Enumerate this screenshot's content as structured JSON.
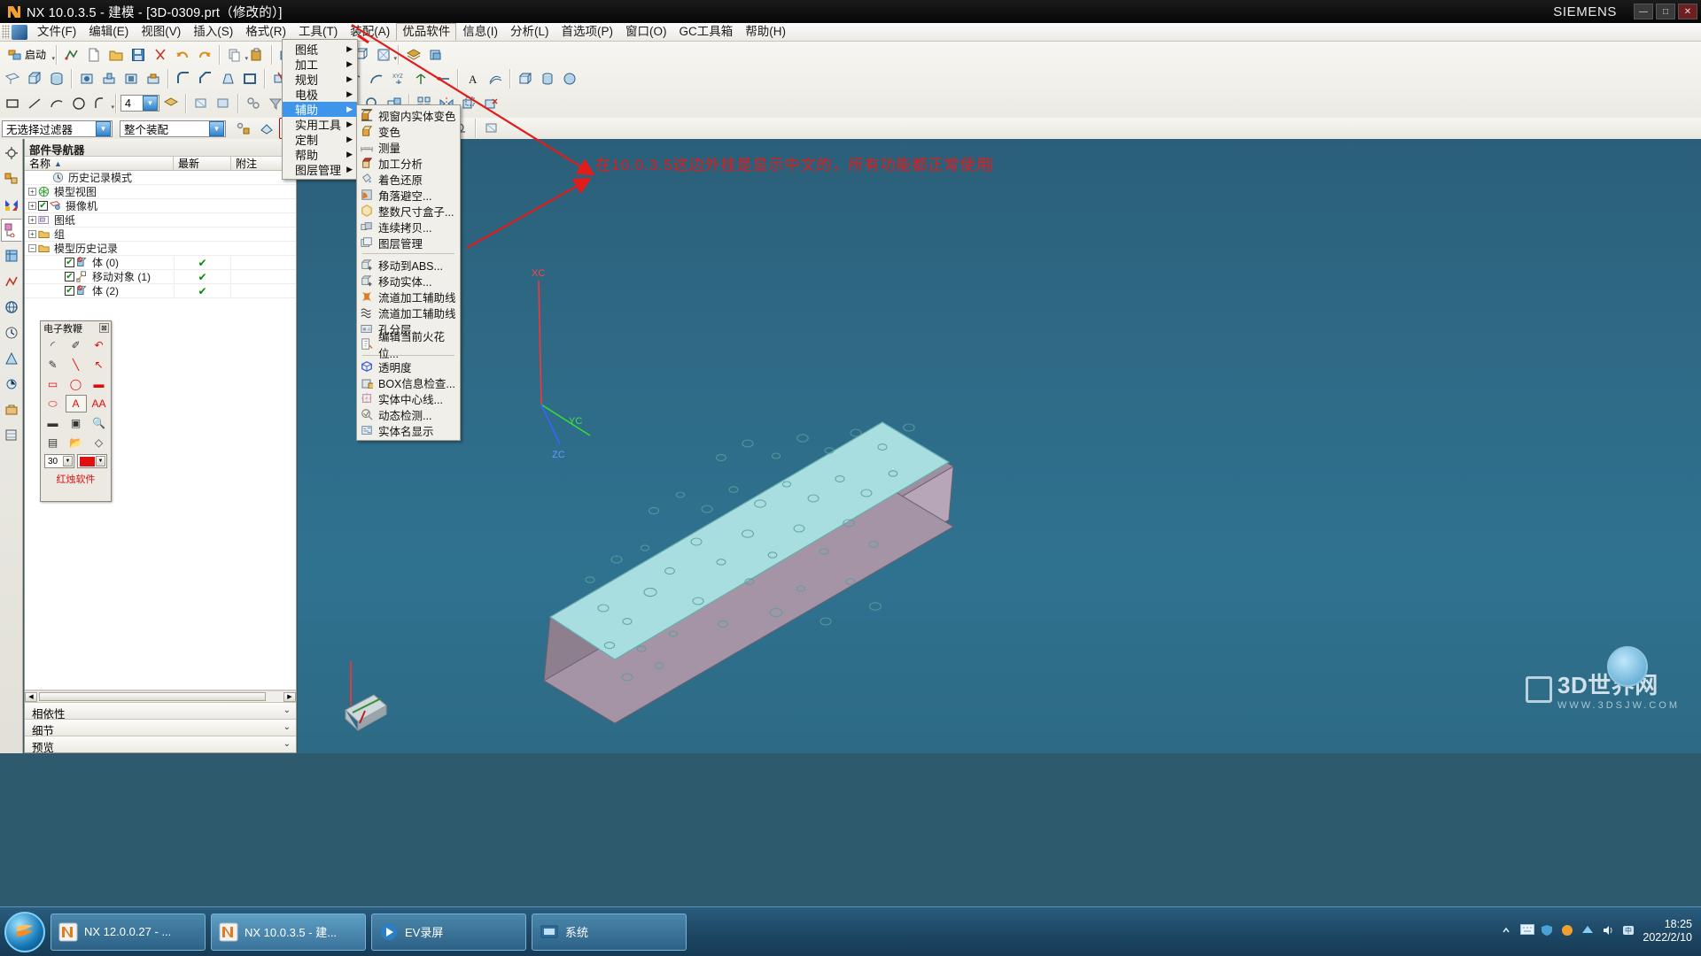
{
  "window": {
    "title": "NX 10.0.3.5 - 建模 - [3D-0309.prt（修改的）]",
    "brand": "SIEMENS",
    "minimize": "—",
    "maximize": "□",
    "close": "✕"
  },
  "menubar": {
    "items": [
      {
        "label": "文件(F)",
        "active": false
      },
      {
        "label": "编辑(E)",
        "active": false
      },
      {
        "label": "视图(V)",
        "active": false
      },
      {
        "label": "插入(S)",
        "active": false
      },
      {
        "label": "格式(R)",
        "active": false
      },
      {
        "label": "工具(T)",
        "active": false
      },
      {
        "label": "装配(A)",
        "active": false
      },
      {
        "label": "优品软件",
        "active": true
      },
      {
        "label": "信息(I)",
        "active": false
      },
      {
        "label": "分析(L)",
        "active": false
      },
      {
        "label": "首选项(P)",
        "active": false
      },
      {
        "label": "窗口(O)",
        "active": false
      },
      {
        "label": "GC工具箱",
        "active": false
      },
      {
        "label": "帮助(H)",
        "active": false
      }
    ]
  },
  "toolbar": {
    "start_label": "启动",
    "number_value": "4"
  },
  "dropdown": {
    "items": [
      {
        "label": "图纸",
        "submenu": true,
        "highlight": false
      },
      {
        "label": "加工",
        "submenu": true,
        "highlight": false
      },
      {
        "label": "规划",
        "submenu": true,
        "highlight": false
      },
      {
        "label": "电极",
        "submenu": true,
        "highlight": false
      },
      {
        "label": "辅助",
        "submenu": true,
        "highlight": true
      },
      {
        "label": "实用工具",
        "submenu": true,
        "highlight": false
      },
      {
        "label": "定制",
        "submenu": true,
        "highlight": false
      },
      {
        "label": "帮助",
        "submenu": true,
        "highlight": false
      },
      {
        "label": "图层管理",
        "submenu": true,
        "highlight": false
      }
    ],
    "arrow_glyph": "▶"
  },
  "submenu": {
    "groups": [
      [
        {
          "label": "视窗内实体变色",
          "icon": "cube-shaded-icon",
          "color": "#d98f2c"
        },
        {
          "label": "变色",
          "icon": "cube-orange-icon",
          "color": "#e8a33a"
        },
        {
          "label": "测量",
          "icon": "measure-icon",
          "color": "#8f8f8f"
        },
        {
          "label": "加工分析",
          "icon": "cube-red-top-icon",
          "color": "#c0392b"
        },
        {
          "label": "着色还原",
          "icon": "paint-bucket-icon",
          "color": "#7fa8c9"
        },
        {
          "label": "角落避空...",
          "icon": "corner-relief-icon",
          "color": "#e07a1f"
        },
        {
          "label": "整数尺寸盒子...",
          "icon": "hex-box-icon",
          "color": "#d6a93c"
        },
        {
          "label": "连续拷贝...",
          "icon": "copy-solid-icon",
          "color": "#9aa3ab"
        },
        {
          "label": "图层管理",
          "icon": "layers-icon",
          "color": "#98a0a8"
        }
      ],
      [
        {
          "label": "移动到ABS...",
          "icon": "move-to-abs-icon",
          "color": "#9aa3ab"
        },
        {
          "label": "移动实体...",
          "icon": "move-solid-icon",
          "color": "#9aa3ab"
        },
        {
          "label": "流道加工辅助线",
          "icon": "runner-machining-icon",
          "color": "#e07a1f"
        },
        {
          "label": "流道加工辅助线",
          "icon": "wave-lines-icon",
          "color": "#3a3a3a"
        },
        {
          "label": "孔分层...",
          "icon": "hole-layer-icon",
          "color": "#8fa0ae"
        },
        {
          "label": "编辑当前火花位...",
          "icon": "edit-spark-gap-icon",
          "color": "#8fa0ae"
        }
      ],
      [
        {
          "label": "透明度",
          "icon": "transparency-cube-icon",
          "color": "#2b4fd8"
        },
        {
          "label": "BOX信息检查...",
          "icon": "box-info-icon",
          "color": "#9aa3ab"
        },
        {
          "label": "实体中心线...",
          "icon": "solid-centerline-icon",
          "color": "#c58fb0"
        },
        {
          "label": "动态检测...",
          "icon": "dynamic-check-icon",
          "color": "#7f7f7f"
        },
        {
          "label": "实体名显示",
          "icon": "solid-name-display-icon",
          "color": "#5f7f9f"
        }
      ]
    ]
  },
  "filter_bar": {
    "selection_filter": "无选择过滤器",
    "scope": "整个装配"
  },
  "navigator": {
    "title": "部件导航器",
    "columns": [
      "名称",
      "最新",
      "附注"
    ],
    "sort_glyph": "▲",
    "rows": [
      {
        "indent": 1,
        "expander": "",
        "label": "历史记录模式",
        "icon": "clock-icon",
        "check": "",
        "latest": ""
      },
      {
        "indent": 0,
        "expander": "+",
        "label": "模型视图",
        "icon": "model-view-icon",
        "check": "",
        "latest": ""
      },
      {
        "indent": 0,
        "expander": "+",
        "label": "摄像机",
        "icon": "camera-icon",
        "check": "✔",
        "latest": ""
      },
      {
        "indent": 0,
        "expander": "+",
        "label": "图纸",
        "icon": "drawing-icon",
        "check": "",
        "latest": ""
      },
      {
        "indent": 0,
        "expander": "+",
        "label": "组",
        "icon": "folder-icon",
        "check": "",
        "latest": ""
      },
      {
        "indent": 0,
        "expander": "−",
        "label": "模型历史记录",
        "icon": "folder-icon",
        "check": "",
        "latest": ""
      },
      {
        "indent": 2,
        "expander": "",
        "label": "体 (0)",
        "icon": "body-icon",
        "check": "✔",
        "latest": "✔"
      },
      {
        "indent": 2,
        "expander": "",
        "label": "移动对象 (1)",
        "icon": "move-object-icon",
        "check": "✔",
        "latest": "✔"
      },
      {
        "indent": 2,
        "expander": "",
        "label": "体 (2)",
        "icon": "body-icon",
        "check": "✔",
        "latest": "✔"
      }
    ],
    "sections": [
      {
        "label": "相依性"
      },
      {
        "label": "细节"
      },
      {
        "label": "预览"
      }
    ],
    "chevron_glyph": "⌄"
  },
  "etool": {
    "title": "电子教鞭",
    "close_glyph": "⊠",
    "tools": [
      {
        "name": "eraser-tool",
        "glyph": "◜"
      },
      {
        "name": "pen-tool",
        "glyph": "✐"
      },
      {
        "name": "undo-tool",
        "glyph": "↶"
      },
      {
        "name": "pencil-tool",
        "glyph": "✎"
      },
      {
        "name": "line-tool",
        "glyph": "╲"
      },
      {
        "name": "arrow-tool",
        "glyph": "↖"
      },
      {
        "name": "rect-outline-tool",
        "glyph": "▭"
      },
      {
        "name": "ellipse-outline-tool",
        "glyph": "◯"
      },
      {
        "name": "rect-filled-tool",
        "glyph": "▬"
      },
      {
        "name": "ellipse-filled-tool",
        "glyph": "⬭"
      },
      {
        "name": "text-tool",
        "glyph": "A"
      },
      {
        "name": "text-size-tool",
        "glyph": "AA"
      },
      {
        "name": "blackboard-tool",
        "glyph": "▬"
      },
      {
        "name": "screenshot-tool",
        "glyph": "▣"
      },
      {
        "name": "zoom-tool",
        "glyph": "🔍"
      },
      {
        "name": "save-tool",
        "glyph": "▤"
      },
      {
        "name": "open-tool",
        "glyph": "📂"
      },
      {
        "name": "shape-tool",
        "glyph": "◇"
      }
    ],
    "size_value": "30",
    "color_value": "#e01010",
    "brand": "红烛软件"
  },
  "annotation": {
    "text": "在10.0.3.5这边外挂是显示中文的，所有功能都正常使用",
    "color": "#e21b1b"
  },
  "viewport": {
    "axes": [
      {
        "label": "XC",
        "color": "#ff2a2a"
      },
      {
        "label": "YC",
        "color": "#2ad52a"
      },
      {
        "label": "ZC",
        "color": "#2a6cff"
      }
    ],
    "watermark_title": "3D世界网",
    "watermark_url": "WWW.3DSJW.COM"
  },
  "taskbar": {
    "tasks": [
      {
        "label": "NX 12.0.0.27 - ...",
        "icon": "nx-icon",
        "active": false
      },
      {
        "label": "NX 10.0.3.5 - 建...",
        "icon": "nx-icon",
        "active": true
      },
      {
        "label": "EV录屏",
        "icon": "ev-icon",
        "active": false
      },
      {
        "label": "系统",
        "icon": "system-icon",
        "active": false
      }
    ],
    "clock_time": "18:25",
    "clock_date": "2022/2/10"
  }
}
